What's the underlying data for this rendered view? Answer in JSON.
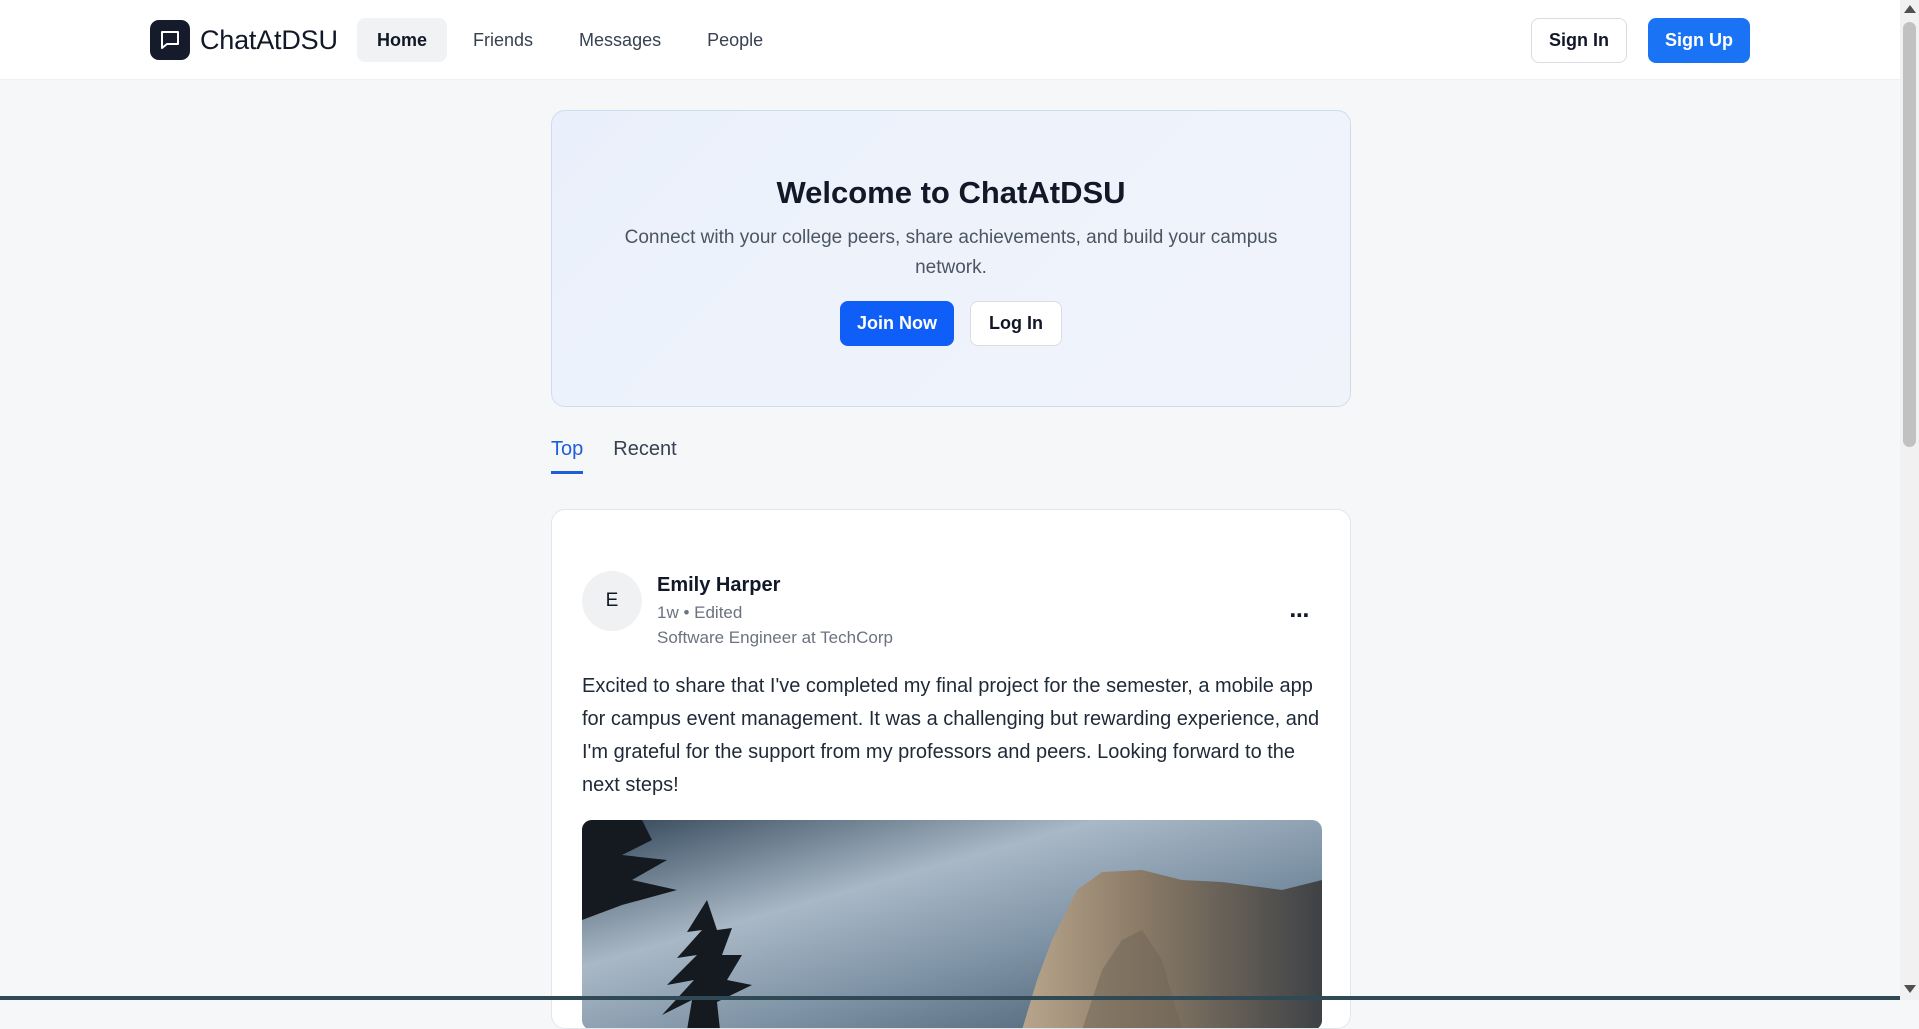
{
  "header": {
    "brand": "ChatAtDSU",
    "nav": [
      {
        "label": "Home",
        "active": true
      },
      {
        "label": "Friends",
        "active": false
      },
      {
        "label": "Messages",
        "active": false
      },
      {
        "label": "People",
        "active": false
      }
    ],
    "sign_in": "Sign In",
    "sign_up": "Sign Up"
  },
  "hero": {
    "title": "Welcome to ChatAtDSU",
    "subtitle": "Connect with your college peers, share achievements, and build your campus network.",
    "join_label": "Join Now",
    "login_label": "Log In"
  },
  "tabs": [
    {
      "label": "Top",
      "active": true
    },
    {
      "label": "Recent",
      "active": false
    }
  ],
  "post": {
    "avatar_initial": "E",
    "author": "Emily Harper",
    "meta": "1w • Edited",
    "headline": "Software Engineer at TechCorp",
    "more_icon": "⋯",
    "body": "Excited to share that I've completed my final project for the semester, a mobile app for campus event management. It was a challenging but rewarding experience, and I'm grateful for the support from my professors and peers. Looking forward to the next steps!"
  },
  "colors": {
    "primary": "#1a73f5",
    "hero_primary": "#0f5ef7",
    "tab_active": "#1d5fd6",
    "brand_logo": "#151b2b"
  }
}
